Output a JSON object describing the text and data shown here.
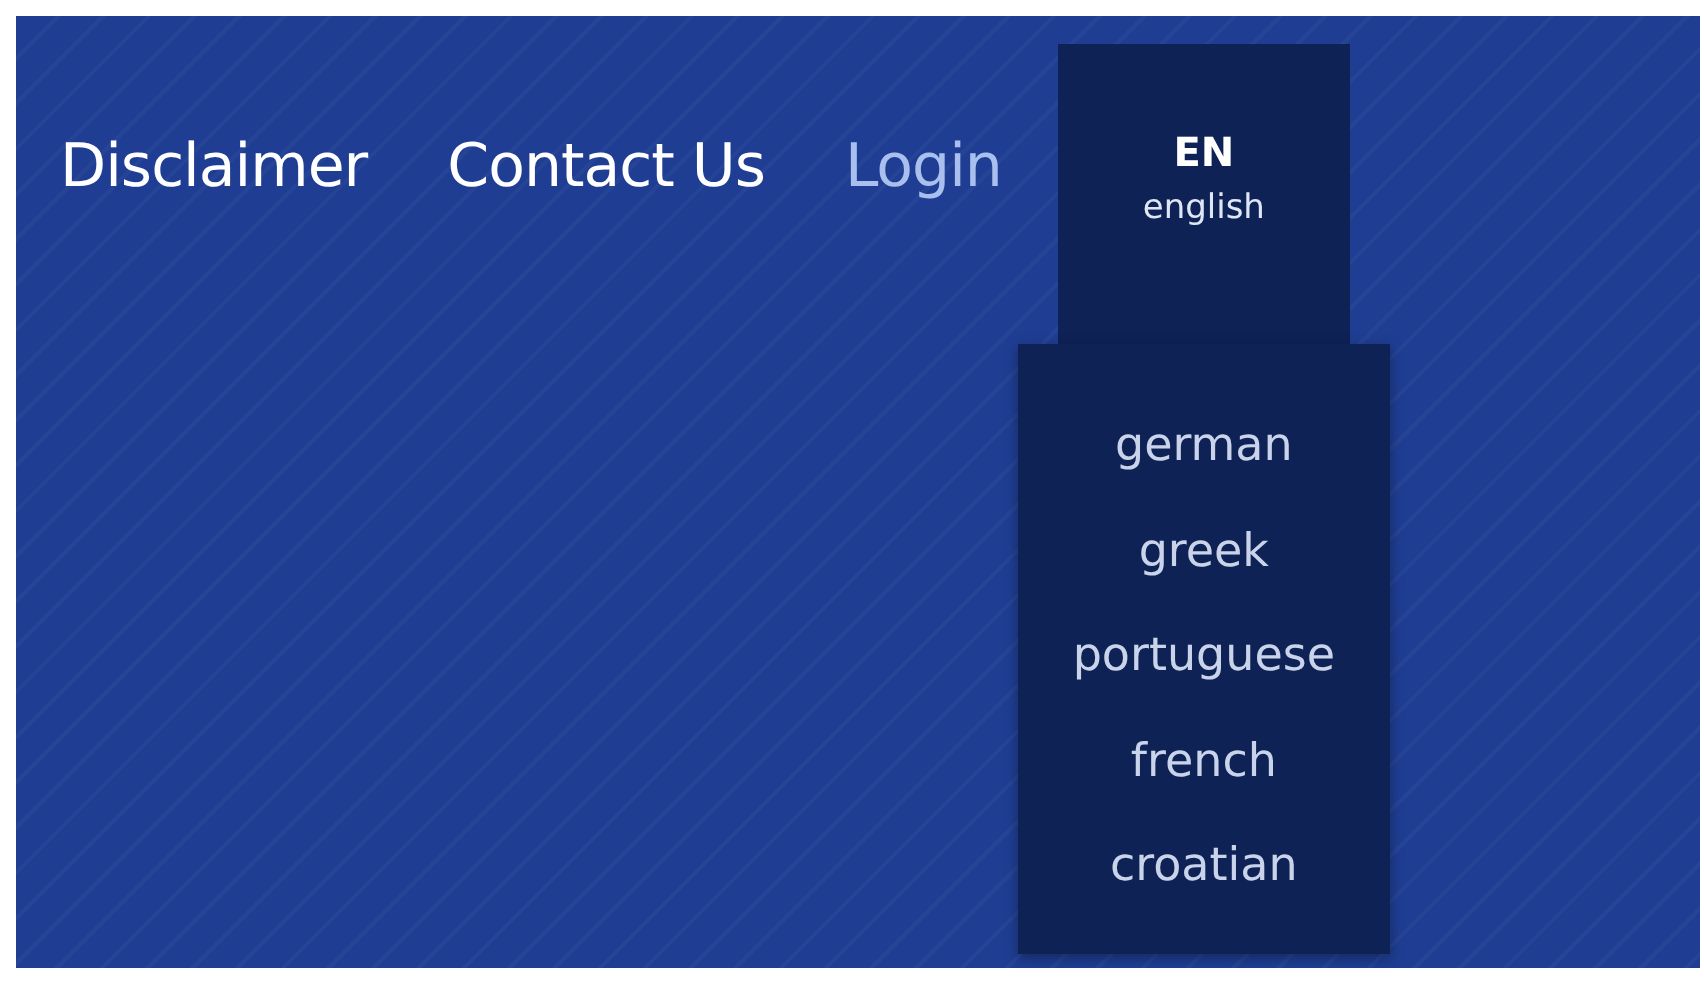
{
  "nav": [
    {
      "label": "Disclaimer",
      "active": false
    },
    {
      "label": "Contact Us",
      "active": false
    },
    {
      "label": "Login",
      "active": true
    }
  ],
  "language": {
    "code": "EN",
    "name": "english",
    "expanded": true,
    "options": [
      {
        "label": "german"
      },
      {
        "label": "greek"
      },
      {
        "label": "portuguese"
      },
      {
        "label": "french"
      },
      {
        "label": "croatian"
      }
    ]
  }
}
